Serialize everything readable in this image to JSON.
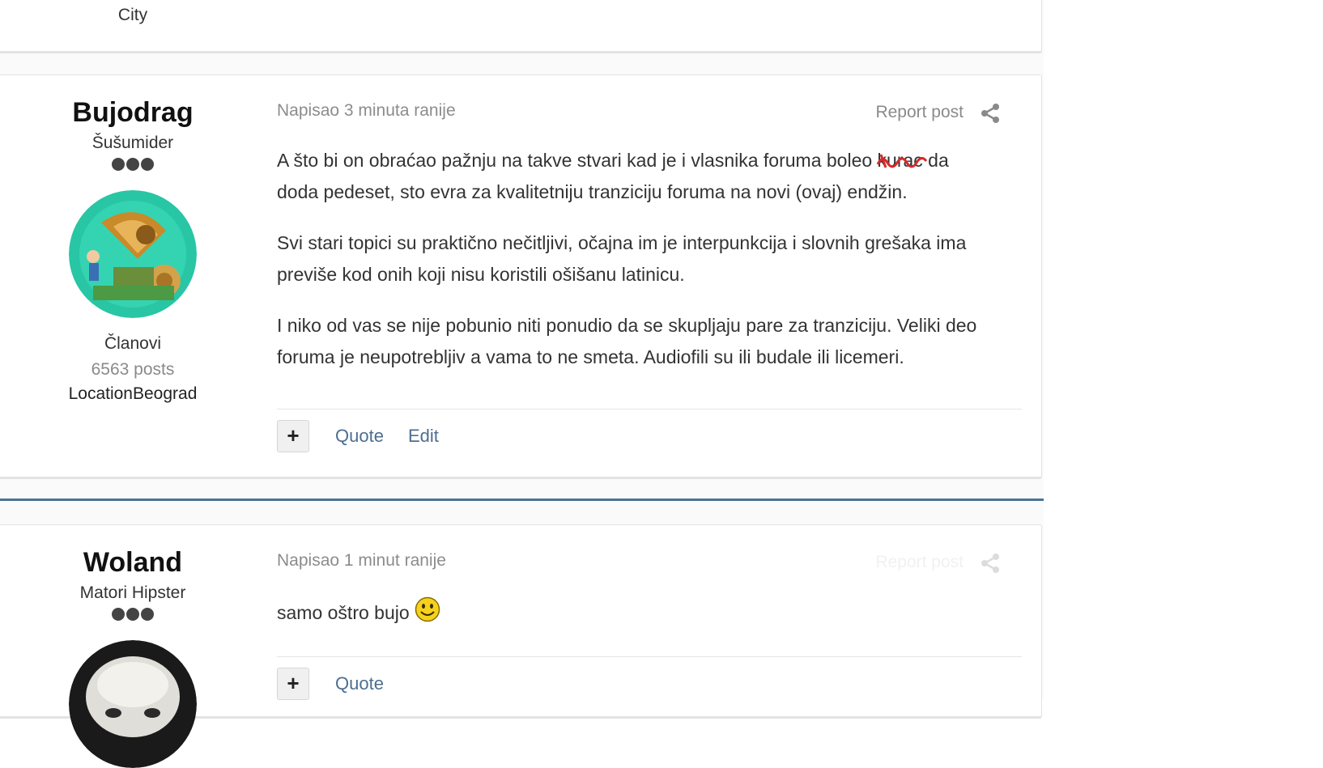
{
  "previous_post": {
    "location_tail": "City"
  },
  "posts": [
    {
      "author": {
        "name": "Bujodrag",
        "rank": "Šušumider",
        "group": "Članovi",
        "posts": "6563 posts",
        "location": "LocationBeograd"
      },
      "meta": "Napisao 3 minuta ranije",
      "report_label": "Report post",
      "paragraphs": [
        "A što bi on obraćao pažnju na takve stvari kad je i vlasnika foruma boleo ",
        "doda pedeset, sto evra za kvalitetniju tranziciju foruma  na novi (ovaj) endžin.",
        "Svi stari topici su praktično nečitljivi, očajna im je interpunkcija i slovnih grešaka ima previše kod onih koji nisu koristili ošišanu latinicu.",
        "I niko od vas se nije pobunio niti ponudio da se skupljaju pare za tranziciju. Veliki deo foruma je neupotrebljiv a vama to ne smeta. Audiofili su ili budale ili licemeri."
      ],
      "redacted_word": "kurac",
      "after_redacted": " da",
      "actions": {
        "plus": "+",
        "quote": "Quote",
        "edit": "Edit"
      }
    },
    {
      "author": {
        "name": "Woland",
        "rank": "Matori Hipster"
      },
      "meta": "Napisao 1 minut ranije",
      "report_label": "Report post",
      "paragraphs": [
        "samo oštro bujo"
      ],
      "actions": {
        "plus": "+",
        "quote": "Quote"
      }
    }
  ],
  "icons": {
    "share": "share-icon",
    "smiley": "smiley-icon"
  },
  "colors": {
    "accent_line": "#4a7394",
    "link": "#4d6e92",
    "meta": "#8c8c8c",
    "squiggle": "#d62a2a"
  }
}
